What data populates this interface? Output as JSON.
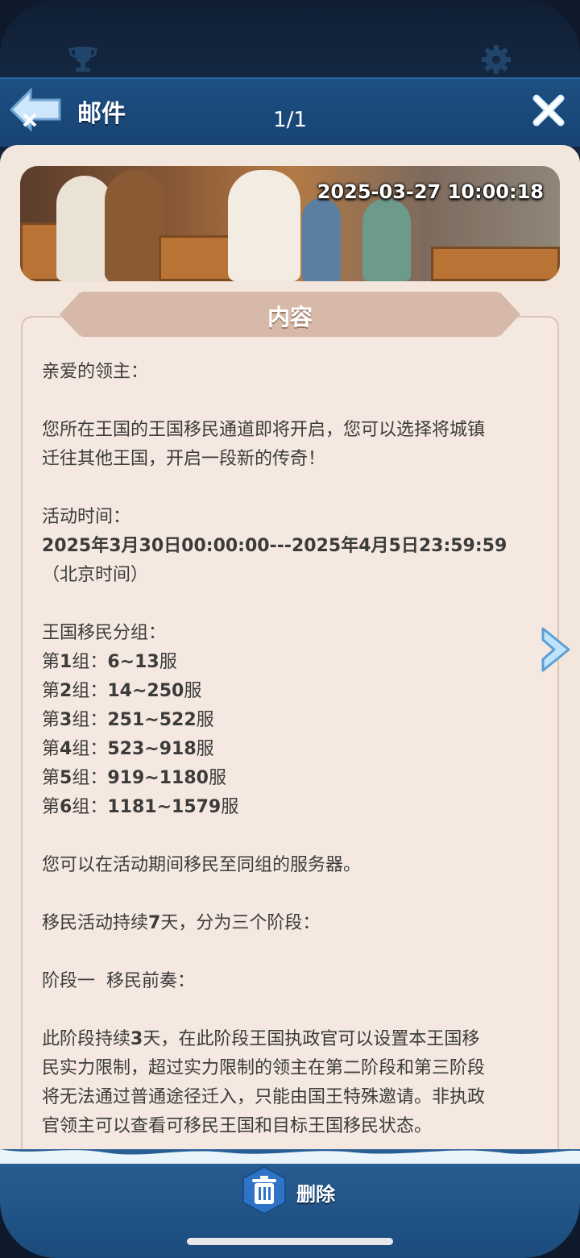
{
  "header": {
    "title": "邮件",
    "page_count": "1/1",
    "icons": [
      "trophy-icon",
      "gear-icon",
      "back-arrow-icon",
      "close-icon"
    ]
  },
  "banner": {
    "datetime": "2025-03-27 10:00:18"
  },
  "content": {
    "section_title": "内容",
    "greeting": "亲爱的领主：",
    "intro_line1": "您所在王国的王国移民通道即将开启，您可以选择将城镇",
    "intro_line2": "迁往其他王国，开启一段新的传奇！",
    "time_label": "活动时间：",
    "time_range": "2025年3月30日00:00:00---2025年4月5日23:59:59",
    "time_zone": "（北京时间）",
    "groups_label": "王国移民分组：",
    "groups": [
      {
        "prefix": "第",
        "num": "1",
        "mid": "组：",
        "range": "6~13",
        "suffix": "服"
      },
      {
        "prefix": "第",
        "num": "2",
        "mid": "组：",
        "range": "14~250",
        "suffix": "服"
      },
      {
        "prefix": "第",
        "num": "3",
        "mid": "组：",
        "range": "251~522",
        "suffix": "服"
      },
      {
        "prefix": "第",
        "num": "4",
        "mid": "组：",
        "range": "523~918",
        "suffix": "服"
      },
      {
        "prefix": "第",
        "num": "5",
        "mid": "组：",
        "range": "919~1180",
        "suffix": "服"
      },
      {
        "prefix": "第",
        "num": "6",
        "mid": "组：",
        "range": "1181~1579",
        "suffix": "服"
      }
    ],
    "same_group_note": "您可以在活动期间移民至同组的服务器。",
    "duration_a": "移民活动持续",
    "duration_num": "7",
    "duration_b": "天，分为三个阶段：",
    "stage1_title": "阶段一  移民前奏：",
    "stage1_a": "此阶段持续",
    "stage1_num": "3",
    "stage1_b": "天，在此阶段王国执政官可以设置本王国移",
    "stage1_line2": "民实力限制，超过实力限制的领主在第二阶段和第三阶段",
    "stage1_line3": "将无法通过普通途径迁入，只能由国王特殊邀请。非执政",
    "stage1_line4": "官领主可以查看可移民王国和目标王国移民状态。"
  },
  "footer": {
    "delete_label": "删除"
  }
}
